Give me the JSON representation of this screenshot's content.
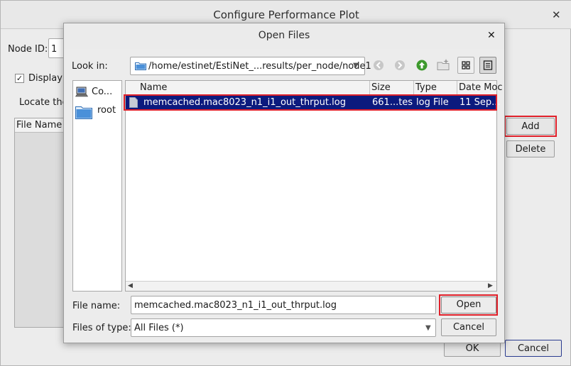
{
  "background_window": {
    "title": "Configure Performance Plot",
    "node_id_label": "Node ID:",
    "node_id_value": "1",
    "display_label": "Display F",
    "locate_label": "Locate the",
    "table_header": "File Name",
    "add_label": "Add",
    "delete_label": "Delete",
    "ok_label": "OK",
    "cancel_label": "Cancel"
  },
  "dialog": {
    "title": "Open Files",
    "look_in_label": "Look in:",
    "look_in_path": "/home/estinet/EstiNet_...results/per_node/node1",
    "places": [
      {
        "label": "Co..."
      },
      {
        "label": "root"
      }
    ],
    "columns": [
      "Name",
      "Size",
      "Type",
      "Date Moc"
    ],
    "files": [
      {
        "name": "memcached.mac8023_n1_i1_out_thrput.log",
        "size": "661...tes",
        "type": "log File",
        "date": "11 Sep..."
      }
    ],
    "file_name_label": "File name:",
    "file_name_value": "memcached.mac8023_n1_i1_out_thrput.log",
    "open_label": "Open",
    "files_of_type_label": "Files of type:",
    "files_of_type_value": "All Files (*)",
    "cancel_label": "Cancel"
  },
  "colors": {
    "selection": "#0c1a7e",
    "highlight_box": "#e0202a",
    "folder": "#4a90d9"
  }
}
